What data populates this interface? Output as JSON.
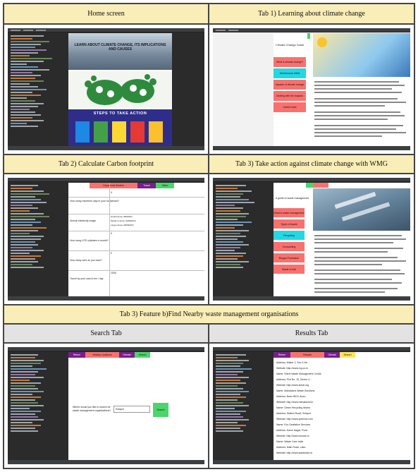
{
  "headers": {
    "home": "Home screen",
    "tab1": "Tab 1) Learning about climate change",
    "tab2": "Tab 2) Calculate Carbon footprint",
    "tab3": "Tab 3) Take action against climate change with WMG",
    "feature": "Tab 3) Feature b)Find Nearby waste management organisations",
    "search": "Search Tab",
    "results": "Results Tab"
  },
  "home": {
    "banner1": "LEARN ABOUT CLIMATE CHANGE, ITS IMPLICATIONS AND CAUSES",
    "banner3": "STEPS TO TAKE ACTION"
  },
  "tab1": {
    "title": "Climate Change Guide",
    "menu": [
      "What is climate change?",
      "Greenhouse effect",
      "Impacts of climate change",
      "Dealing with the impacts",
      "Useful Links"
    ]
  },
  "tab2": {
    "title": "Household Section",
    "tabs": [
      "Household Section",
      "Travel",
      "Other"
    ],
    "questions": [
      "How many members stay in your household?",
      "Annual electricity usage",
      "How many LPG cylinders a month?",
      "How many cars do you have?",
      "Travel by your cars in km / day"
    ],
    "options": [
      "Small House (900kWh)",
      "Medium House (1800kWh)",
      "Large House (3000kWh)"
    ],
    "values": [
      "3",
      "0",
      "0",
      "1000"
    ]
  },
  "tab3": {
    "title": "A guide to waste management",
    "menu": [
      "What is waste management",
      "Types of waste",
      "Recycling",
      "Composting",
      "Biogas Production",
      "Waste to fuel"
    ]
  },
  "search": {
    "tabs": [
      "Return",
      "Nearby Locations",
      "Climate",
      "Search"
    ],
    "prompt": "Where would you like to search for waste management organisations?",
    "value": "Solapur",
    "button": "Search"
  },
  "results": {
    "tabs": [
      "Return",
      "Results",
      "Climate",
      "Search"
    ],
    "entries": [
      "Address: Maker 2, Sec 4 Ne...",
      "Website: http://www.nrg.co.in",
      "Name: Shirdi Waste Management Centre",
      "Address: Plot No. 15, Sector 4...",
      "Website: http://www.shirdi.org",
      "Name: Mahalaxmi Waste Solutions",
      "Address: Near MIDC Area...",
      "Website: http://www.mahalaxmi.in",
      "Name: Green Recycling Works",
      "Address: Station Road, Solapur",
      "Website: http://www.greenrw.com",
      "Name: Eco Sanitation Services",
      "Address: Karve Nagar, Pune",
      "Website: http://www.ecosan.in",
      "Name: Waste Care India",
      "Address: Main Road, Latur",
      "Website: http://www.wastecare.in"
    ]
  },
  "colors": {
    "header_bg": "#f9edb8",
    "header_gray": "#e3e3e3",
    "ide_bg": "#2b2b2b",
    "salmon": "#f8716e",
    "cyan": "#22d8e4",
    "green": "#4ad66a",
    "purple": "#7a1c8e",
    "yellow": "#ffe65c"
  }
}
